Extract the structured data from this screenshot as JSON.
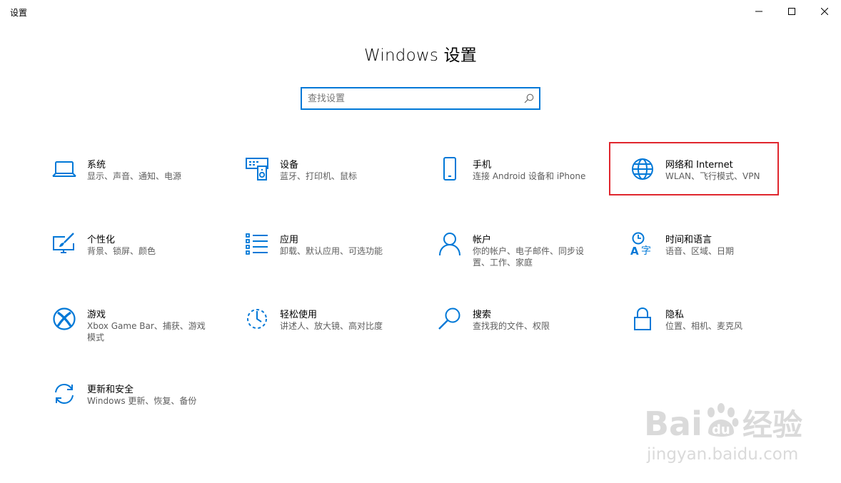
{
  "window": {
    "title": "设置",
    "controls": [
      "minimize-icon",
      "maximize-icon",
      "close-icon"
    ]
  },
  "header": {
    "title": "Windows 设置"
  },
  "search": {
    "placeholder": "查找设置",
    "value": ""
  },
  "accent": "#0078d7",
  "highlight_color": "#e0262e",
  "tiles": [
    {
      "name": "系统",
      "desc": "显示、声音、通知、电源",
      "icon": "laptop-icon"
    },
    {
      "name": "设备",
      "desc": "蓝牙、打印机、鼠标",
      "icon": "keyboard-speaker-icon"
    },
    {
      "name": "手机",
      "desc": "连接 Android 设备和 iPhone",
      "icon": "phone-icon"
    },
    {
      "name": "网络和 Internet",
      "desc": "WLAN、飞行模式、VPN",
      "icon": "globe-icon",
      "highlighted": true
    },
    {
      "name": "个性化",
      "desc": "背景、锁屏、颜色",
      "icon": "paint-monitor-icon"
    },
    {
      "name": "应用",
      "desc": "卸载、默认应用、可选功能",
      "icon": "apps-list-icon"
    },
    {
      "name": "帐户",
      "desc": "你的帐户、电子邮件、同步设置、工作、家庭",
      "icon": "person-icon"
    },
    {
      "name": "时间和语言",
      "desc": "语音、区域、日期",
      "icon": "time-language-icon"
    },
    {
      "name": "游戏",
      "desc": "Xbox Game Bar、捕获、游戏模式",
      "icon": "xbox-icon"
    },
    {
      "name": "轻松使用",
      "desc": "讲述人、放大镜、高对比度",
      "icon": "ease-of-access-icon"
    },
    {
      "name": "搜索",
      "desc": "查找我的文件、权限",
      "icon": "search-icon"
    },
    {
      "name": "隐私",
      "desc": "位置、相机、麦克风",
      "icon": "lock-icon"
    },
    {
      "name": "更新和安全",
      "desc": "Windows 更新、恢复、备份",
      "icon": "sync-icon"
    }
  ],
  "watermark": {
    "logo": "Bai du 经验",
    "url": "jingyan.baidu.com"
  }
}
